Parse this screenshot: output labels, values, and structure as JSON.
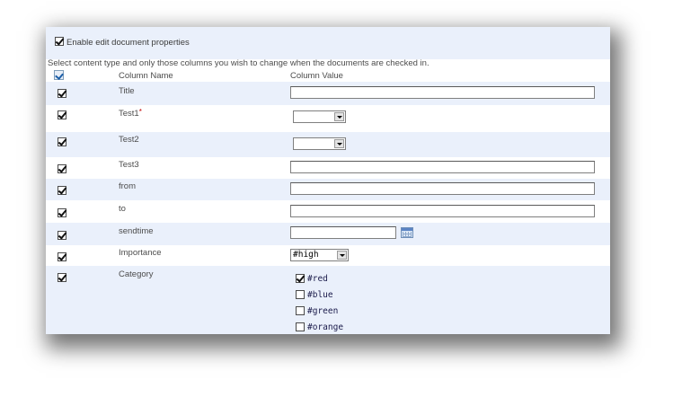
{
  "enable": {
    "label": "Enable edit document properties",
    "checked": true
  },
  "instructions": "Select content type and only those columns you wish to change when the documents are checked in.",
  "headers": {
    "column_name": "Column Name",
    "column_value": "Column Value"
  },
  "rows": [
    {
      "name": "Title",
      "checked": true,
      "control": "text",
      "value": ""
    },
    {
      "name": "Test1",
      "required_marker": "*",
      "checked": true,
      "control": "select",
      "value": ""
    },
    {
      "name": "Test2",
      "checked": true,
      "control": "select",
      "value": ""
    },
    {
      "name": "Test3",
      "checked": true,
      "control": "text",
      "value": ""
    },
    {
      "name": "from",
      "checked": true,
      "control": "text",
      "value": ""
    },
    {
      "name": "to",
      "checked": true,
      "control": "text",
      "value": ""
    },
    {
      "name": "sendtime",
      "checked": true,
      "control": "date",
      "value": ""
    },
    {
      "name": "Importance",
      "checked": true,
      "control": "select",
      "value": "#high"
    },
    {
      "name": "Category",
      "checked": true,
      "control": "checkbox-list",
      "options": [
        {
          "label": "#red",
          "checked": true
        },
        {
          "label": "#blue",
          "checked": false
        },
        {
          "label": "#green",
          "checked": false
        },
        {
          "label": "#orange",
          "checked": false
        }
      ]
    }
  ],
  "colors": {
    "alt_row": "#eaf0fb",
    "border": "#7f7f7f"
  },
  "icons": {
    "calendar": "calendar-icon",
    "dropdown": "chevron-down-icon"
  }
}
